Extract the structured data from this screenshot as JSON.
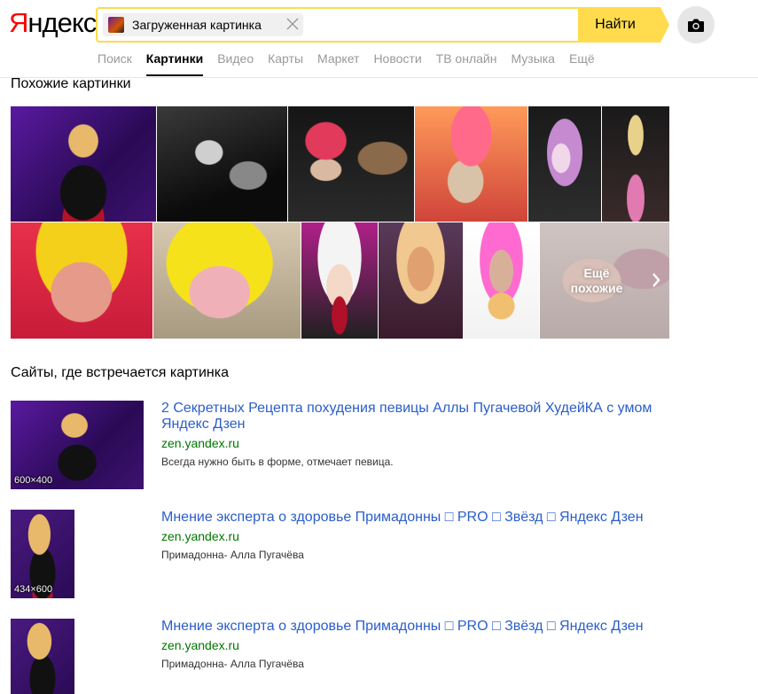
{
  "logo": {
    "first": "Я",
    "rest": "ндекс"
  },
  "search": {
    "chip_text": "Загруженная картинка",
    "button_label": "Найти"
  },
  "tabs": [
    {
      "label": "Поиск"
    },
    {
      "label": "Картинки",
      "active": true
    },
    {
      "label": "Видео"
    },
    {
      "label": "Карты"
    },
    {
      "label": "Маркет"
    },
    {
      "label": "Новости"
    },
    {
      "label": "ТВ онлайн"
    },
    {
      "label": "Музыка"
    },
    {
      "label": "Ещё"
    }
  ],
  "similar": {
    "heading": "Похожие картинки",
    "more_label_line1": "Ещё",
    "more_label_line2": "похожие"
  },
  "sites": {
    "heading": "Сайты, где встречается картинка",
    "items": [
      {
        "title": "2 Секретных Рецепта похудения певицы Аллы Пугачевой ХудейКА с умом Яндекс Дзен",
        "host": "zen.yandex.ru",
        "desc": "Всегда нужно быть в форме, отмечает певица.",
        "size": "600×400"
      },
      {
        "title": "Мнение эксперта о здоровье Примадонны □ PRO □ Звёзд □ Яндекс Дзен",
        "host": "zen.yandex.ru",
        "desc": "Примадонна- Алла Пугачёва",
        "size": "434×600"
      },
      {
        "title": "Мнение эксперта о здоровье Примадонны □ PRO □ Звёзд □ Яндекс Дзен",
        "host": "zen.yandex.ru",
        "desc": "Примадонна- Алла Пугачёва",
        "size": ""
      }
    ]
  },
  "colors": {
    "accent_yellow": "#ffdb4d",
    "link_blue": "#2a5dcb",
    "host_green": "#007700",
    "logo_red": "#ff0000"
  }
}
